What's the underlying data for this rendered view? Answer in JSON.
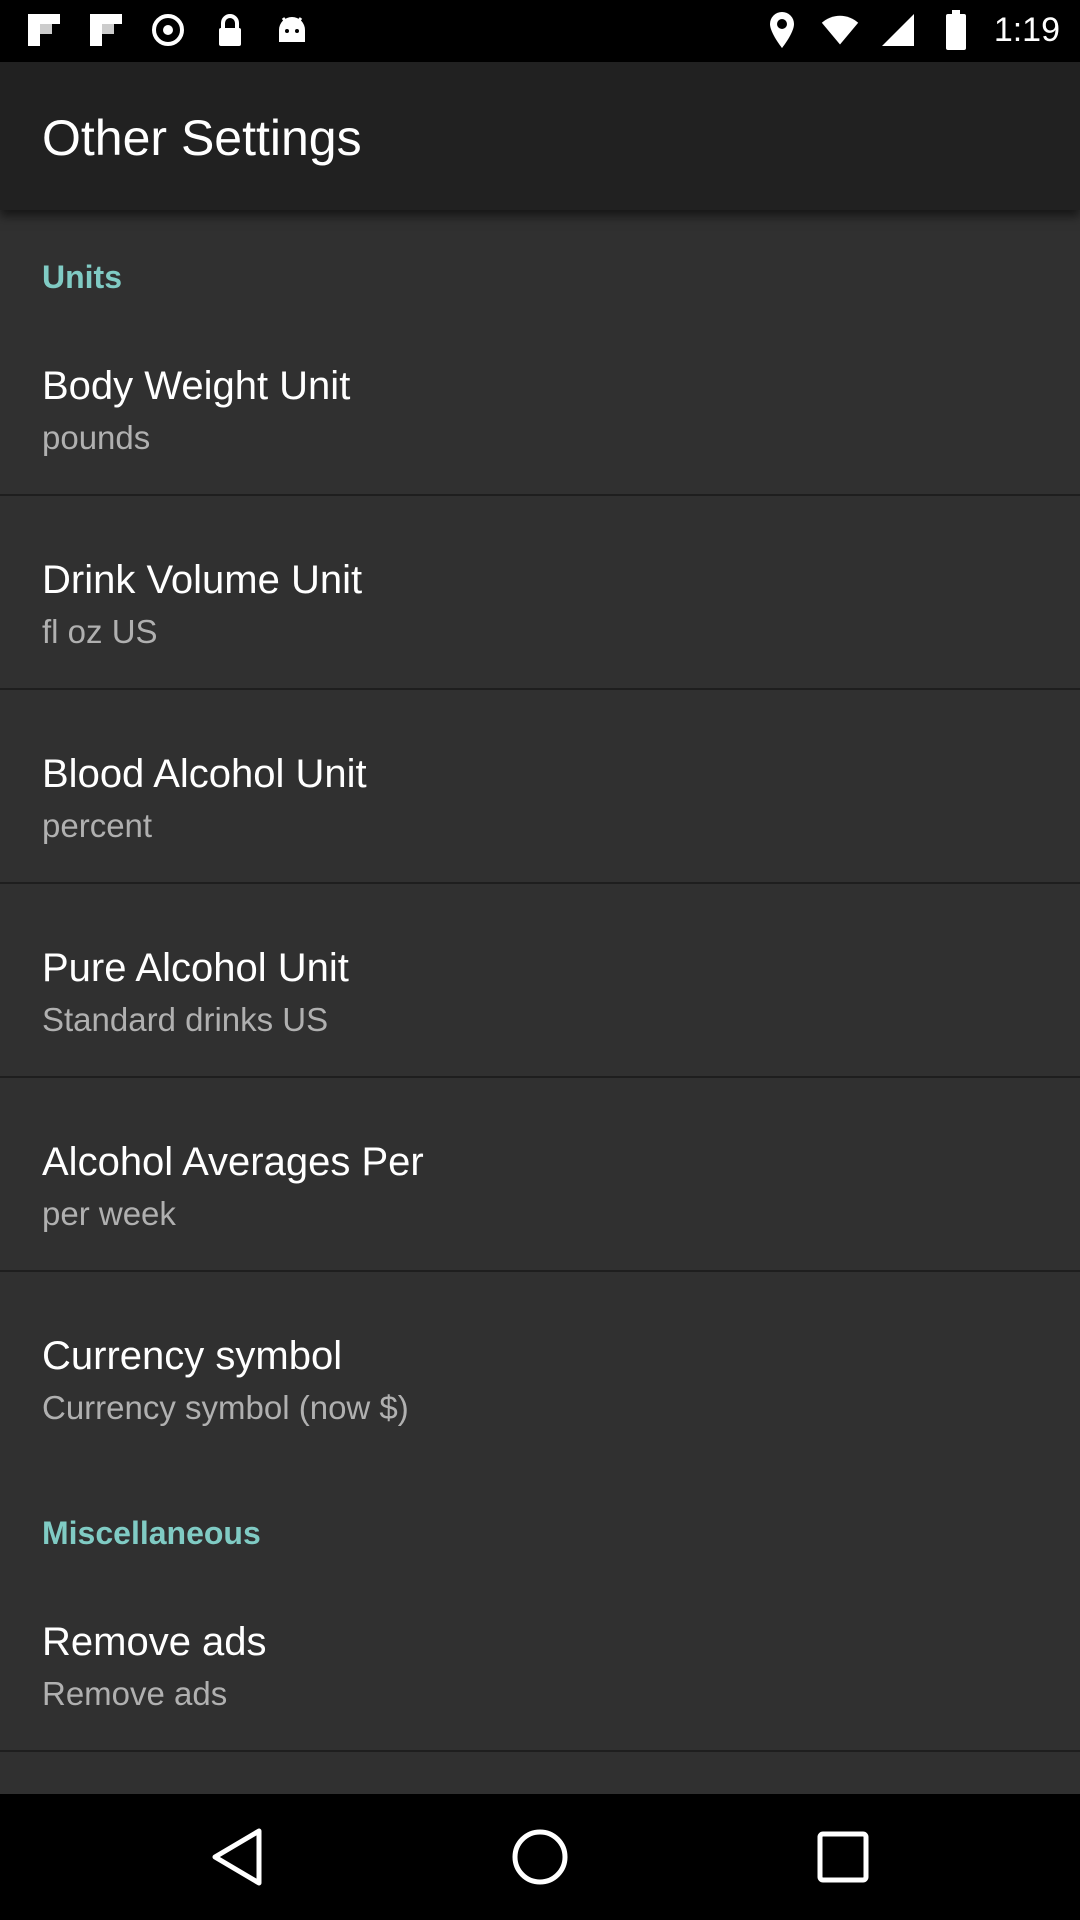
{
  "status_bar": {
    "time": "1:19",
    "left_icons": [
      "flipboard-icon",
      "flipboard-icon",
      "alarm-icon",
      "lock-icon",
      "android-icon"
    ],
    "right_icons": [
      "location-icon",
      "wifi-icon",
      "signal-icon",
      "battery-icon"
    ]
  },
  "app_bar": {
    "title": "Other Settings"
  },
  "sections": [
    {
      "header": "Units",
      "items": [
        {
          "title": "Body Weight Unit",
          "summary": "pounds"
        },
        {
          "title": "Drink Volume Unit",
          "summary": "fl oz US"
        },
        {
          "title": "Blood Alcohol Unit",
          "summary": "percent"
        },
        {
          "title": "Pure Alcohol Unit",
          "summary": "Standard drinks US"
        },
        {
          "title": "Alcohol Averages Per",
          "summary": "per week"
        },
        {
          "title": "Currency symbol",
          "summary": "Currency symbol (now $)"
        }
      ]
    },
    {
      "header": "Miscellaneous",
      "items": [
        {
          "title": "Remove ads",
          "summary": "Remove ads"
        }
      ]
    }
  ],
  "colors": {
    "background": "#303030",
    "app_bar": "#212121",
    "accent": "#80cbc4",
    "summary_text": "#b0b0b0"
  },
  "nav_bar": {
    "buttons": [
      "back-icon",
      "home-icon",
      "recents-icon"
    ]
  }
}
